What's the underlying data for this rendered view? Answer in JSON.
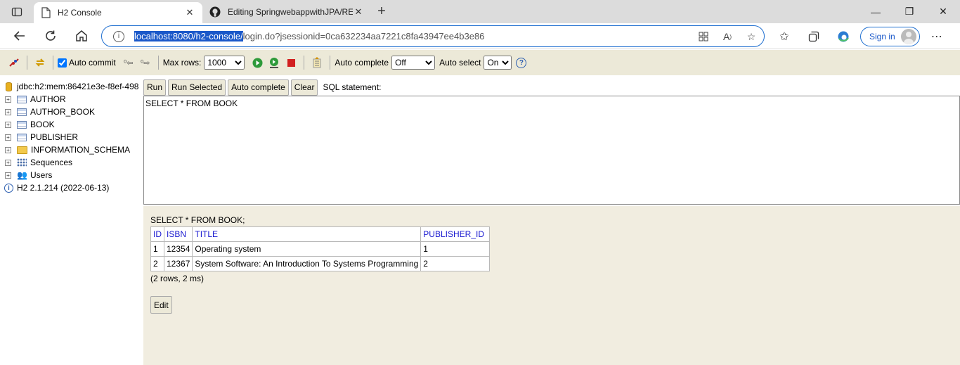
{
  "browser": {
    "tabs": [
      {
        "title": "H2 Console",
        "active": true
      },
      {
        "title": "Editing SpringwebappwithJPA/RE",
        "active": false
      }
    ],
    "url_selected": "localhost:8080/h2-console/",
    "url_rest": "login.do?jsessionid=0ca632234aa7221c8fa43947ee4b3e86",
    "signin_label": "Sign in"
  },
  "h2toolbar": {
    "auto_commit_label": "Auto commit",
    "auto_commit_checked": true,
    "max_rows_label": "Max rows:",
    "max_rows_value": "1000",
    "auto_complete_label": "Auto complete",
    "auto_complete_value": "Off",
    "auto_select_label": "Auto select",
    "auto_select_value": "On",
    "help_icon": "?"
  },
  "tree": {
    "connection": "jdbc:h2:mem:86421e3e-f8ef-498",
    "items": [
      {
        "label": "AUTHOR",
        "icon": "table-icon"
      },
      {
        "label": "AUTHOR_BOOK",
        "icon": "table-icon"
      },
      {
        "label": "BOOK",
        "icon": "table-icon"
      },
      {
        "label": "PUBLISHER",
        "icon": "table-icon"
      },
      {
        "label": "INFORMATION_SCHEMA",
        "icon": "folder-icon"
      },
      {
        "label": "Sequences",
        "icon": "sequences-icon"
      },
      {
        "label": "Users",
        "icon": "users-icon"
      }
    ],
    "version": "H2 2.1.214 (2022-06-13)"
  },
  "query": {
    "buttons": {
      "run": "Run",
      "run_selected": "Run Selected",
      "auto_complete": "Auto complete",
      "clear": "Clear"
    },
    "sql_label": "SQL statement:",
    "sql_text": "SELECT * FROM BOOK"
  },
  "results": {
    "executed": "SELECT * FROM BOOK;",
    "columns": [
      "ID",
      "ISBN",
      "TITLE",
      "PUBLISHER_ID"
    ],
    "rows": [
      [
        "1",
        "12354",
        "Operating system",
        "1"
      ],
      [
        "2",
        "12367",
        "System Software: An Introduction To Systems Programming",
        "2"
      ]
    ],
    "info": "(2 rows, 2 ms)",
    "edit_label": "Edit"
  }
}
